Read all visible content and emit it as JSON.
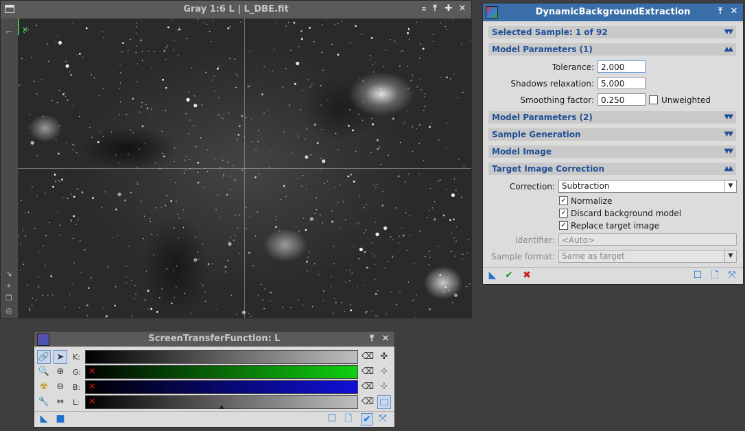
{
  "image_window": {
    "title": "Gray 1:6 L | L_DBE.fit",
    "buttons": {
      "shade": "⌅",
      "collapse": "⤒",
      "maximize": "✚",
      "close": "✕"
    }
  },
  "dbe": {
    "title": "DynamicBackgroundExtraction",
    "sections": {
      "selected_sample": "Selected Sample: 1 of 92",
      "model_params_1": "Model Parameters (1)",
      "model_params_2": "Model Parameters (2)",
      "sample_generation": "Sample Generation",
      "model_image": "Model Image",
      "target_correction": "Target Image Correction"
    },
    "tolerance": {
      "label": "Tolerance:",
      "value": "2.000"
    },
    "shadows": {
      "label": "Shadows relaxation:",
      "value": "5.000"
    },
    "smoothing": {
      "label": "Smoothing factor:",
      "value": "0.250"
    },
    "unweighted": {
      "label": "Unweighted",
      "checked": false
    },
    "correction": {
      "label": "Correction:",
      "value": "Subtraction"
    },
    "normalize": {
      "label": "Normalize",
      "checked": true
    },
    "discard": {
      "label": "Discard background model",
      "checked": true
    },
    "replace": {
      "label": "Replace target image",
      "checked": true
    },
    "identifier": {
      "label": "Identifier:",
      "placeholder": "<Auto>"
    },
    "sample_format": {
      "label": "Sample format:",
      "value": "Same as target"
    }
  },
  "stf": {
    "title": "ScreenTransferFunction: L",
    "channels": [
      {
        "label": "K:",
        "color": "#bfbfbf"
      },
      {
        "label": "G:",
        "color": "#10d010"
      },
      {
        "label": "B:",
        "color": "#1010d8"
      },
      {
        "label": "L:",
        "color": "#bfbfbf"
      }
    ],
    "midtone_marker": 0.5
  },
  "colors": {
    "accent_blue": "#3a6ea8",
    "section_text": "#1f4f96",
    "panel_bg": "#dcdcdc",
    "workspace": "#3e3e3e"
  }
}
